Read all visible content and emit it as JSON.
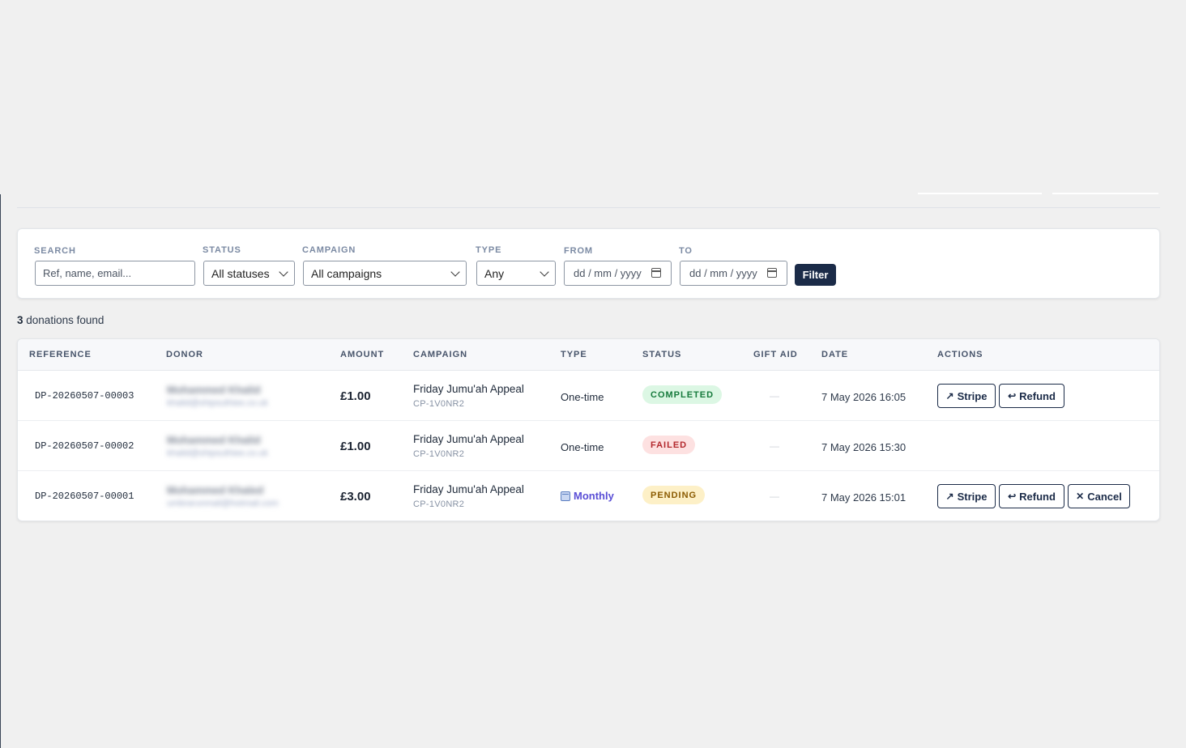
{
  "filters": {
    "search": {
      "label": "SEARCH",
      "placeholder": "Ref, name, email..."
    },
    "status": {
      "label": "STATUS",
      "value": "All statuses"
    },
    "campaign": {
      "label": "CAMPAIGN",
      "value": "All campaigns"
    },
    "type": {
      "label": "TYPE",
      "value": "Any"
    },
    "from": {
      "label": "FROM",
      "placeholder": "dd / mm / yyyy"
    },
    "to": {
      "label": "TO",
      "placeholder": "dd / mm / yyyy"
    },
    "filter_button": "Filter"
  },
  "results": {
    "count": "3",
    "label": "donations found"
  },
  "table": {
    "headers": {
      "reference": "REFERENCE",
      "donor": "DONOR",
      "amount": "AMOUNT",
      "campaign": "CAMPAIGN",
      "type": "TYPE",
      "status": "STATUS",
      "gift_aid": "GIFT AID",
      "date": "DATE",
      "actions": "ACTIONS"
    },
    "rows": [
      {
        "reference": "DP-20260507-00003",
        "donor_name": "Mohammed Khalid",
        "donor_email": "khalid@shipsuthiee.co.uk",
        "amount": "£1.00",
        "campaign_name": "Friday Jumu'ah Appeal",
        "campaign_code": "CP-1V0NR2",
        "type": "One-time",
        "status": "COMPLETED",
        "gift_aid": "—",
        "date": "7 May 2026 16:05",
        "actions": {
          "stripe": "Stripe",
          "refund": "Refund"
        }
      },
      {
        "reference": "DP-20260507-00002",
        "donor_name": "Mohammed Khalid",
        "donor_email": "khalid@shipsuthiee.co.uk",
        "amount": "£1.00",
        "campaign_name": "Friday Jumu'ah Appeal",
        "campaign_code": "CP-1V0NR2",
        "type": "One-time",
        "status": "FAILED",
        "gift_aid": "—",
        "date": "7 May 2026 15:30"
      },
      {
        "reference": "DP-20260507-00001",
        "donor_name": "Mohammed Khaled",
        "donor_email": "umbrarunmail@hotmail.com",
        "amount": "£3.00",
        "campaign_name": "Friday Jumu'ah Appeal",
        "campaign_code": "CP-1V0NR2",
        "type": "Monthly",
        "status": "PENDING",
        "gift_aid": "—",
        "date": "7 May 2026 15:01",
        "actions": {
          "stripe": "Stripe",
          "refund": "Refund",
          "cancel": "Cancel"
        }
      }
    ]
  },
  "icons": {
    "external_link": "arrow-up-right-icon",
    "refund": "return-arrow-icon",
    "cancel": "close-icon",
    "recurring": "calendar-recurring-icon",
    "dropdown": "chevron-down-icon",
    "date_picker": "calendar-icon"
  },
  "colors": {
    "primary": "#1b2b48",
    "completed_bg": "#dcf7e4",
    "completed_text": "#167a3c",
    "failed_bg": "#fde1e1",
    "failed_text": "#b3282d",
    "pending_bg": "#fdf0c7",
    "pending_text": "#8a5a00",
    "monthly_text": "#5a4fd6"
  }
}
